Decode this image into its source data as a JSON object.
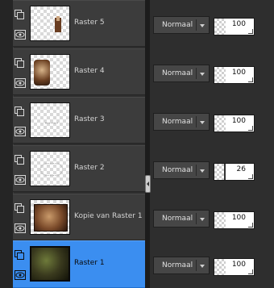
{
  "layers": [
    {
      "name": "Raster 5",
      "blend_mode": "Normaal",
      "opacity": 100,
      "selected": false,
      "thumb": "small-figure"
    },
    {
      "name": "Raster 4",
      "blend_mode": "Normaal",
      "opacity": 100,
      "selected": false,
      "thumb": "brown-portrait"
    },
    {
      "name": "Raster 3",
      "blend_mode": "Normaal",
      "opacity": 100,
      "selected": false,
      "thumb": "faint-text"
    },
    {
      "name": "Raster 2",
      "blend_mode": "Normaal",
      "opacity": 26,
      "selected": false,
      "thumb": "faint-pattern"
    },
    {
      "name": "Kopie van Raster 1",
      "blend_mode": "Normaal",
      "opacity": 100,
      "selected": false,
      "thumb": "brown-texture"
    },
    {
      "name": "Raster 1",
      "blend_mode": "Normaal",
      "opacity": 100,
      "selected": true,
      "thumb": "dark-green-texture"
    }
  ],
  "icons": {
    "lock": "lock-icon",
    "visibility": "eye-icon",
    "dropdown": "chevron-down-icon",
    "splitter": "collapse-handle-icon"
  },
  "colors": {
    "selected": "#3b8ef0",
    "row": "#3c3c3c",
    "background": "#2e2e2e"
  }
}
